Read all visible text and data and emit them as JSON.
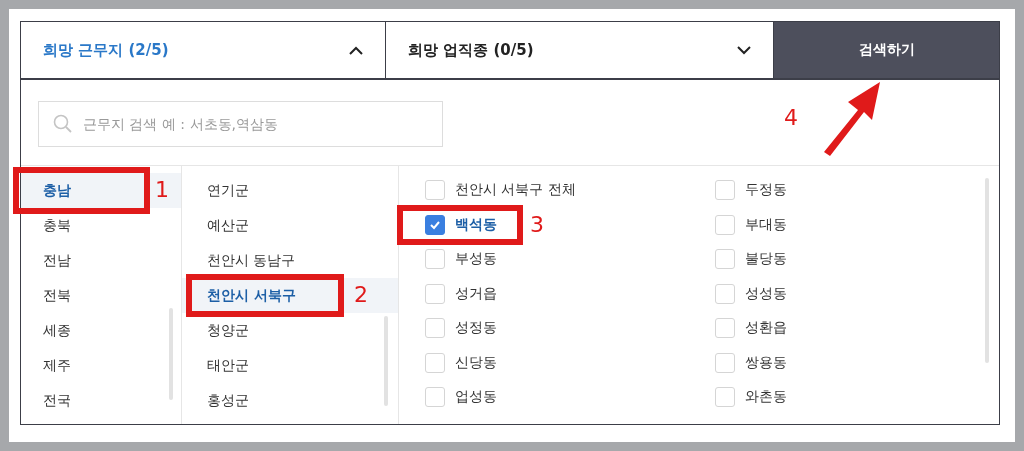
{
  "tabs": [
    {
      "label": "희망 근무지 (2/5)",
      "expanded": true
    },
    {
      "label": "희망 업직종 (0/5)",
      "expanded": false
    }
  ],
  "search_button": {
    "label": "검색하기",
    "annotation": "4"
  },
  "search": {
    "placeholder": "근무지 검색 예 : 서초동,역삼동"
  },
  "regions": {
    "annotation": "1",
    "items": [
      {
        "label": "충남",
        "selected": true
      },
      {
        "label": "충북",
        "selected": false
      },
      {
        "label": "전남",
        "selected": false
      },
      {
        "label": "전북",
        "selected": false
      },
      {
        "label": "세종",
        "selected": false
      },
      {
        "label": "제주",
        "selected": false
      },
      {
        "label": "전국",
        "selected": false
      }
    ]
  },
  "districts": {
    "annotation": "2",
    "items": [
      {
        "label": "연기군",
        "selected": false
      },
      {
        "label": "예산군",
        "selected": false
      },
      {
        "label": "천안시 동남구",
        "selected": false
      },
      {
        "label": "천안시 서북구",
        "selected": true
      },
      {
        "label": "청양군",
        "selected": false
      },
      {
        "label": "태안군",
        "selected": false
      },
      {
        "label": "홍성군",
        "selected": false
      }
    ]
  },
  "neighborhoods": {
    "annotation": "3",
    "items": [
      {
        "label": "천안시 서북구 전체",
        "checked": false
      },
      {
        "label": "두정동",
        "checked": false
      },
      {
        "label": "백석동",
        "checked": true
      },
      {
        "label": "부대동",
        "checked": false
      },
      {
        "label": "부성동",
        "checked": false
      },
      {
        "label": "불당동",
        "checked": false
      },
      {
        "label": "성거읍",
        "checked": false
      },
      {
        "label": "성성동",
        "checked": false
      },
      {
        "label": "성정동",
        "checked": false
      },
      {
        "label": "성환읍",
        "checked": false
      },
      {
        "label": "신당동",
        "checked": false
      },
      {
        "label": "쌍용동",
        "checked": false
      },
      {
        "label": "업성동",
        "checked": false
      },
      {
        "label": "와촌동",
        "checked": false
      }
    ]
  }
}
